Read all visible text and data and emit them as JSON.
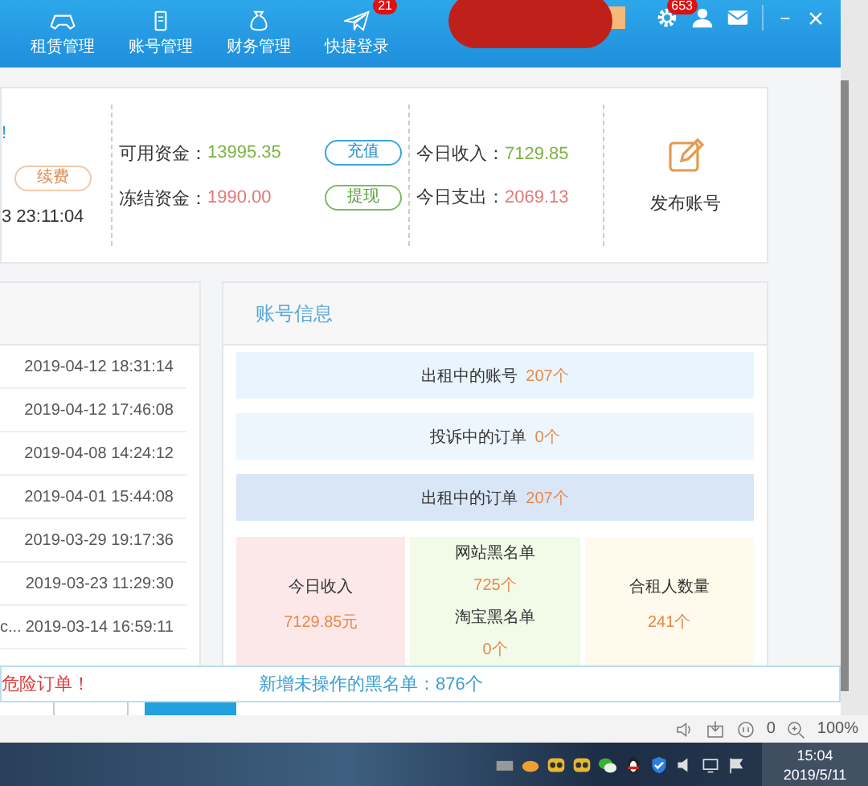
{
  "header": {
    "nav": [
      {
        "label": "租赁管理"
      },
      {
        "label": "账号管理"
      },
      {
        "label": "财务管理"
      },
      {
        "label": "快捷登录",
        "badge": "21"
      }
    ],
    "settings_badge": "653"
  },
  "summary": {
    "title_fragment": "!",
    "renew_button": "续费",
    "time_fragment": "3 23:11:04",
    "funds": [
      {
        "label": "可用资金：",
        "value": "13995.35",
        "color": "#7cb342",
        "button": "充值"
      },
      {
        "label": "冻结资金：",
        "value": "1990.00",
        "color": "#e07b7b",
        "button": "提现"
      }
    ],
    "today": [
      {
        "label": "今日收入：",
        "value": "7129.85",
        "color": "#7cb342"
      },
      {
        "label": "今日支出：",
        "value": "2069.13",
        "color": "#e07b7b"
      }
    ],
    "publish": "发布账号"
  },
  "recent_list": {
    "rows": [
      {
        "time": "2019-04-12 18:31:14"
      },
      {
        "time": "2019-04-12 17:46:08"
      },
      {
        "time": "2019-04-08 14:24:12"
      },
      {
        "time": "2019-04-01 15:44:08"
      },
      {
        "time": "2019-03-29 19:17:36"
      },
      {
        "time": "2019-03-23 11:29:30"
      },
      {
        "fragment": "c...",
        "time": "2019-03-14 16:59:11"
      }
    ]
  },
  "account_info": {
    "title": "账号信息",
    "bars": [
      {
        "label": "出租中的账号",
        "count": "207个",
        "highlight": false
      },
      {
        "label": "投诉中的订单",
        "count": "0个",
        "highlight": false
      },
      {
        "label": "出租中的订单",
        "count": "207个",
        "highlight": true
      }
    ],
    "stats": [
      {
        "kind": "single",
        "color": "#fde8e9",
        "label": "今日收入",
        "value": "7129.85元"
      },
      {
        "kind": "double",
        "color": "#f1fbe8",
        "items": [
          {
            "label": "网站黑名单",
            "value": "725个"
          },
          {
            "label": "淘宝黑名单",
            "value": "0个"
          }
        ]
      },
      {
        "kind": "single",
        "color": "#fffaeb",
        "label": "合租人数量",
        "value": "241个"
      }
    ]
  },
  "notice": {
    "alert": "危险订单！",
    "blacklist": "新增未操作的黑名单：876个"
  },
  "browser_status": {
    "blocked_count": "0",
    "zoom": "100%"
  },
  "taskbar": {
    "time": "15:04",
    "date": "2019/5/11"
  }
}
